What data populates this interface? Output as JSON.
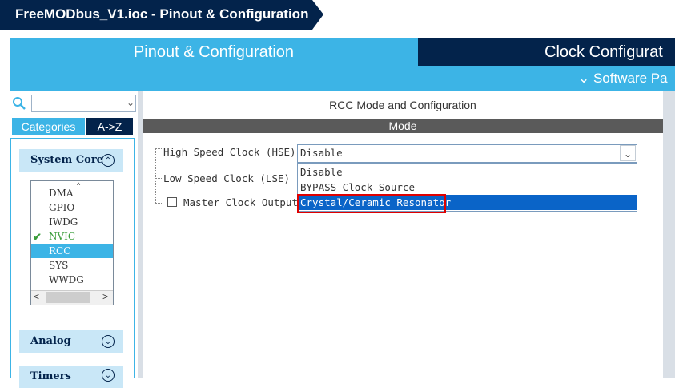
{
  "window": {
    "title": "FreeMODbus_V1.ioc - Pinout & Configuration"
  },
  "tabs": [
    {
      "label": "Pinout & Configuration",
      "active": true
    },
    {
      "label": "Clock Configurat",
      "active": false
    }
  ],
  "subbar": {
    "software_packs": "⌄ Software Pa"
  },
  "left_panel": {
    "search_placeholder": "",
    "tab_categories": "Categories",
    "tab_az": "A->Z",
    "categories": {
      "system_core": "System Core",
      "analog": "Analog",
      "timers": "Timers"
    },
    "system_core_items": [
      {
        "label": "DMA",
        "state": "normal"
      },
      {
        "label": "GPIO",
        "state": "normal"
      },
      {
        "label": "IWDG",
        "state": "normal"
      },
      {
        "label": "NVIC",
        "state": "checked"
      },
      {
        "label": "RCC",
        "state": "selected"
      },
      {
        "label": "SYS",
        "state": "normal"
      },
      {
        "label": "WWDG",
        "state": "normal"
      }
    ]
  },
  "rcc": {
    "header": "RCC Mode and Configuration",
    "mode_label": "Mode",
    "hse_label": "High Speed Clock (HSE)",
    "hse_value": "Disable",
    "lse_label": "Low Speed Clock (LSE)",
    "mco_label": "Master Clock Output",
    "mco_checked": false,
    "hse_options": [
      {
        "label": "Disable",
        "selected": false
      },
      {
        "label": "BYPASS Clock Source",
        "selected": false
      },
      {
        "label": "Crystal/Ceramic Resonator",
        "selected": true
      }
    ]
  },
  "colors": {
    "navy": "#03234b",
    "accent": "#3cb4e6",
    "highlight_border": "#e00000",
    "selection": "#0a64c8"
  },
  "icons": [
    "search-icon",
    "chevron-down-icon",
    "collapse-up-icon",
    "expand-down-icon",
    "check-icon"
  ]
}
